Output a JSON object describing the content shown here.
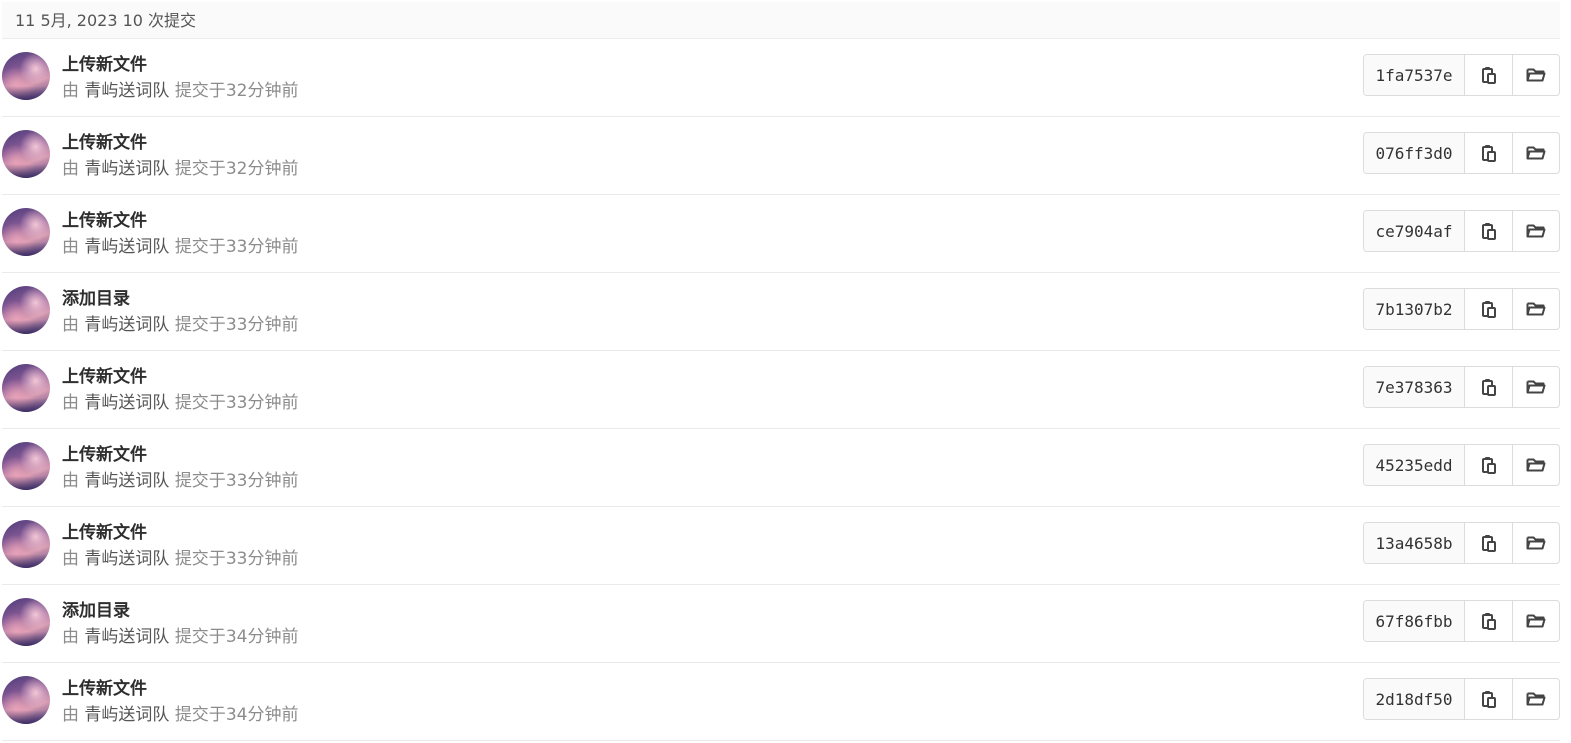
{
  "day_header": {
    "label": "11 5月, 2023 10 次提交"
  },
  "icons": {
    "copy": "clipboard-icon",
    "browse": "folder-open-icon"
  },
  "commits": [
    {
      "title": "上传新文件",
      "by": "由",
      "author": "青屿送词队",
      "action": "提交于",
      "time": "32分钟前",
      "sha": "1fa7537e"
    },
    {
      "title": "上传新文件",
      "by": "由",
      "author": "青屿送词队",
      "action": "提交于",
      "time": "32分钟前",
      "sha": "076ff3d0"
    },
    {
      "title": "上传新文件",
      "by": "由",
      "author": "青屿送词队",
      "action": "提交于",
      "time": "33分钟前",
      "sha": "ce7904af"
    },
    {
      "title": "添加目录",
      "by": "由",
      "author": "青屿送词队",
      "action": "提交于",
      "time": "33分钟前",
      "sha": "7b1307b2"
    },
    {
      "title": "上传新文件",
      "by": "由",
      "author": "青屿送词队",
      "action": "提交于",
      "time": "33分钟前",
      "sha": "7e378363"
    },
    {
      "title": "上传新文件",
      "by": "由",
      "author": "青屿送词队",
      "action": "提交于",
      "time": "33分钟前",
      "sha": "45235edd"
    },
    {
      "title": "上传新文件",
      "by": "由",
      "author": "青屿送词队",
      "action": "提交于",
      "time": "33分钟前",
      "sha": "13a4658b"
    },
    {
      "title": "添加目录",
      "by": "由",
      "author": "青屿送词队",
      "action": "提交于",
      "time": "34分钟前",
      "sha": "67f86fbb"
    },
    {
      "title": "上传新文件",
      "by": "由",
      "author": "青屿送词队",
      "action": "提交于",
      "time": "34分钟前",
      "sha": "2d18df50"
    }
  ]
}
